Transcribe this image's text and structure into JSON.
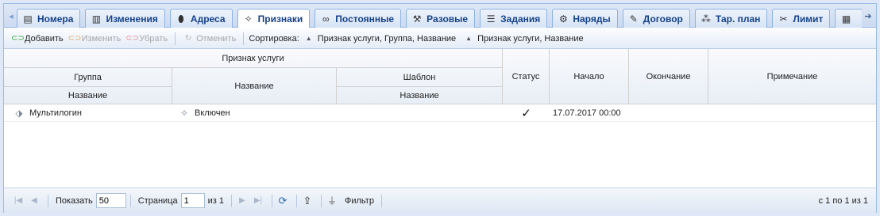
{
  "tabs": [
    {
      "label": "Номера",
      "icon": "sim-card-icon"
    },
    {
      "label": "Изменения",
      "icon": "document-icon"
    },
    {
      "label": "Адреса",
      "icon": "map-pin-icon"
    },
    {
      "label": "Признаки",
      "icon": "tag-sparkle-icon",
      "active": true
    },
    {
      "label": "Постоянные",
      "icon": "link-icon"
    },
    {
      "label": "Разовые",
      "icon": "wrench-icon"
    },
    {
      "label": "Задания",
      "icon": "task-list-icon"
    },
    {
      "label": "Наряды",
      "icon": "tools-icon"
    },
    {
      "label": "Договор",
      "icon": "contract-icon"
    },
    {
      "label": "Тар. план",
      "icon": "network-icon"
    },
    {
      "label": "Лимит",
      "icon": "scissors-icon"
    }
  ],
  "toolbar": {
    "add": "Добавить",
    "edit": "Изменить",
    "remove": "Убрать",
    "cancel": "Отменить",
    "sort_label": "Сортировка:",
    "sort_items": [
      "Признак услуги, Группа, Название",
      "Признак услуги, Название"
    ]
  },
  "columns": {
    "service_attr": "Признак услуги",
    "group": "Группа",
    "group_name": "Название",
    "name": "Название",
    "template": "Шаблон",
    "template_name": "Название",
    "status": "Статус",
    "start": "Начало",
    "end": "Окончание",
    "note": "Примечание"
  },
  "rows": [
    {
      "group_name": "Мультилогин",
      "name": "Включен",
      "template_name": "",
      "status": "✓",
      "start": "17.07.2017 00:00",
      "end": "",
      "note": ""
    }
  ],
  "pager": {
    "show_label": "Показать",
    "page_size": "50",
    "page_label": "Страница",
    "page": "1",
    "of_label": "из 1",
    "filter_label": "Фильтр",
    "summary": "с 1 по 1 из 1"
  },
  "colors": {
    "accent": "#15428b",
    "border": "#99bbe8"
  }
}
